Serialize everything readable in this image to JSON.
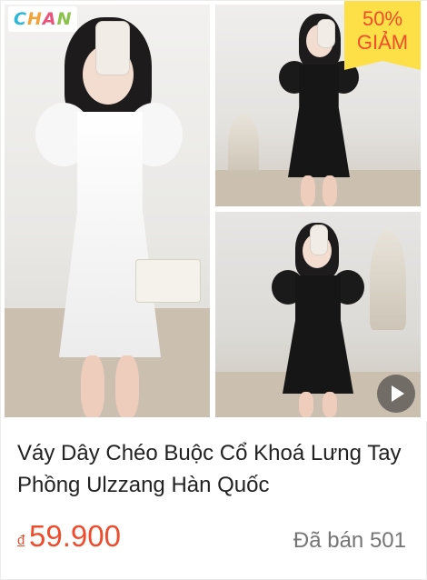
{
  "product": {
    "brand_logo": "CHAN",
    "discount_badge": {
      "percent": "50%",
      "text": "GIẢM"
    },
    "title": "Váy Dây Chéo Buộc Cổ Khoá Lưng Tay Phồng Ulzzang Hàn Quốc",
    "price_currency": "đ",
    "price": "59.900",
    "sold": "Đã bán 501",
    "has_video": true
  },
  "colors": {
    "accent": "#ee4d2d",
    "badge_bg": "#fde047",
    "muted_text": "#757575"
  }
}
